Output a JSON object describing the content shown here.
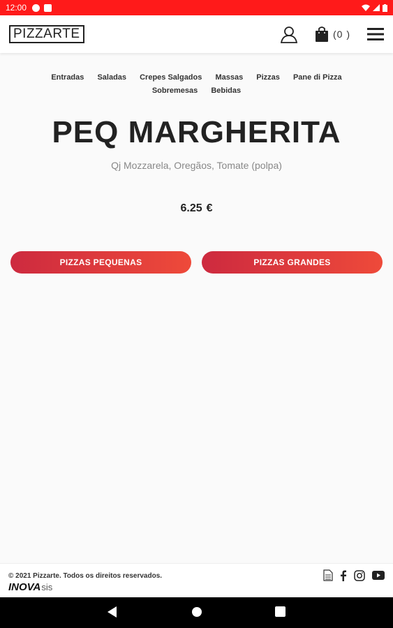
{
  "status_bar": {
    "time": "12:00"
  },
  "header": {
    "logo": "PIZZARTE",
    "cart_count": "(0 )"
  },
  "nav": {
    "row1": [
      "Entradas",
      "Saladas",
      "Crepes Salgados",
      "Massas",
      "Pizzas",
      "Pane di Pizza"
    ],
    "row2": [
      "Sobremesas",
      "Bebidas"
    ]
  },
  "product": {
    "title": "PEQ MARGHERITA",
    "description": "Qj Mozzarela, Oregãos, Tomate (polpa)",
    "price": "6.25",
    "currency": "€"
  },
  "buttons": {
    "left": "PIZZAS PEQUENAS",
    "right": "PIZZAS GRANDES"
  },
  "footer": {
    "copyright": "© 2021 Pizzarte. Todos os direitos reservados.",
    "brand_main": "INOVA",
    "brand_sis": "sis",
    "icons": [
      "document-icon",
      "facebook-icon",
      "instagram-icon",
      "youtube-icon"
    ]
  },
  "colors": {
    "status_bar": "#ff1a1a",
    "button_start": "#cd2a3f",
    "button_end": "#ee4a3a"
  }
}
